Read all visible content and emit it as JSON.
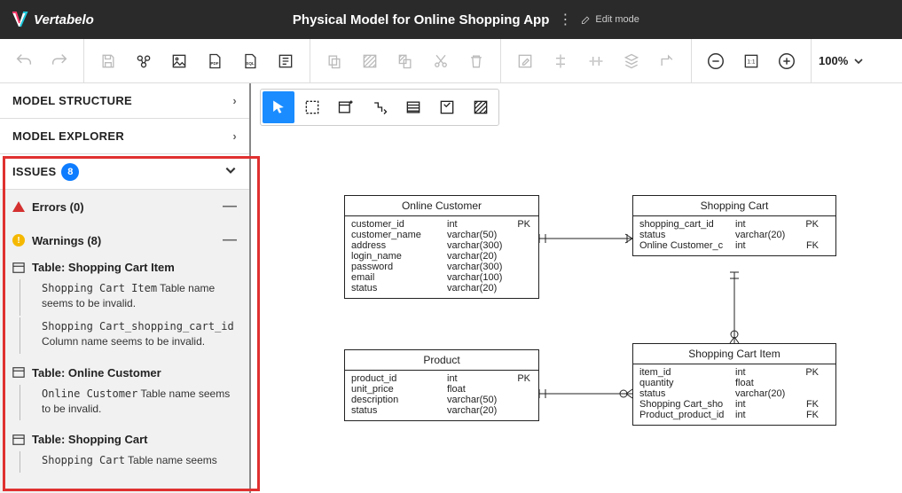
{
  "brand": "Vertabelo",
  "title": "Physical Model for Online Shopping App",
  "edit_mode": "Edit mode",
  "zoom": "100%",
  "sidebar": {
    "structure": "MODEL STRUCTURE",
    "explorer": "MODEL EXPLORER",
    "issues_label": "ISSUES",
    "issues_count": "8",
    "errors_label": "Errors (0)",
    "warnings_label": "Warnings (8)",
    "items": [
      {
        "hdr": "Table: Shopping Cart Item",
        "msgs": [
          {
            "mono": "Shopping Cart Item",
            "rest": " Table name seems to be invalid."
          },
          {
            "mono": "Shopping Cart_shopping_cart_id",
            "rest": " Column name seems to be invalid."
          }
        ]
      },
      {
        "hdr": "Table: Online Customer",
        "msgs": [
          {
            "mono": "Online Customer",
            "rest": " Table name seems to be invalid."
          }
        ]
      },
      {
        "hdr": "Table: Shopping Cart",
        "msgs": [
          {
            "mono": "Shopping Cart",
            "rest": " Table name seems"
          }
        ]
      }
    ]
  },
  "entities": {
    "cust": {
      "title": "Online Customer",
      "rows": [
        [
          "customer_id",
          "int",
          "PK"
        ],
        [
          "customer_name",
          "varchar(50)",
          ""
        ],
        [
          "address",
          "varchar(300)",
          ""
        ],
        [
          "login_name",
          "varchar(20)",
          ""
        ],
        [
          "password",
          "varchar(300)",
          ""
        ],
        [
          "email",
          "varchar(100)",
          ""
        ],
        [
          "status",
          "varchar(20)",
          ""
        ]
      ]
    },
    "cart": {
      "title": "Shopping Cart",
      "rows": [
        [
          "shopping_cart_id",
          "int",
          "PK"
        ],
        [
          "status",
          "varchar(20)",
          ""
        ],
        [
          "Online Customer_c",
          "int",
          "FK"
        ]
      ]
    },
    "prod": {
      "title": "Product",
      "rows": [
        [
          "product_id",
          "int",
          "PK"
        ],
        [
          "unit_price",
          "float",
          ""
        ],
        [
          "description",
          "varchar(50)",
          ""
        ],
        [
          "status",
          "varchar(20)",
          ""
        ]
      ]
    },
    "item": {
      "title": "Shopping Cart Item",
      "rows": [
        [
          "item_id",
          "int",
          "PK"
        ],
        [
          "quantity",
          "float",
          ""
        ],
        [
          "status",
          "varchar(20)",
          ""
        ],
        [
          "Shopping Cart_sho",
          "int",
          "FK"
        ],
        [
          "Product_product_id",
          "int",
          "FK"
        ]
      ]
    }
  }
}
